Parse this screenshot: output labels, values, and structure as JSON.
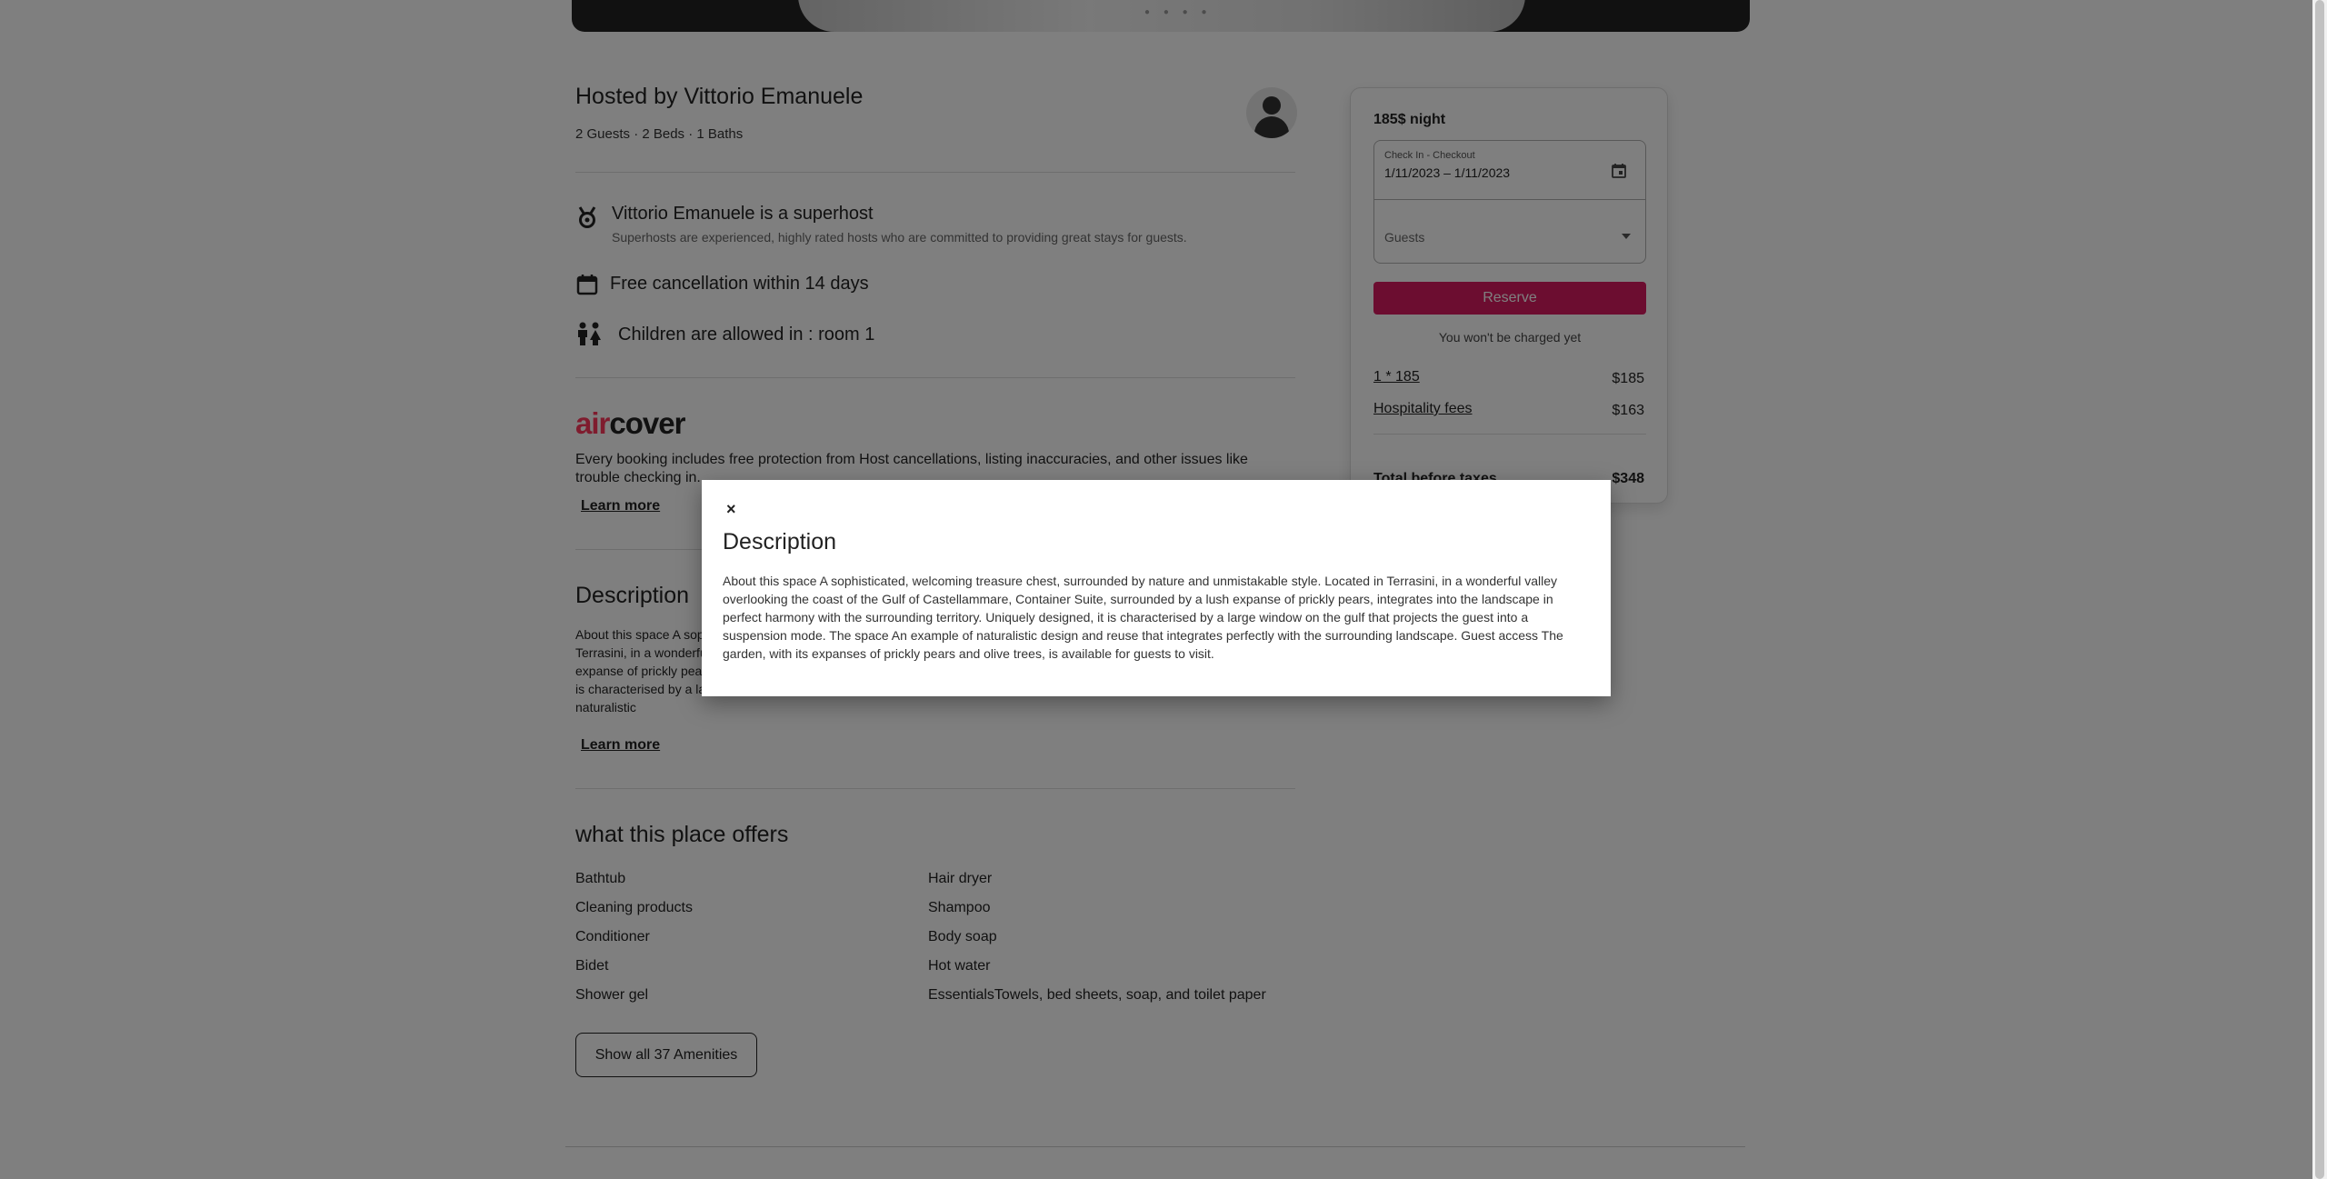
{
  "host": {
    "title": "Hosted by Vittorio Emanuele",
    "subtitle": "2 Guests · 2 Beds · 1 Baths"
  },
  "features": [
    {
      "icon": "medal-icon",
      "title": "Vittorio Emanuele is a superhost",
      "desc": "Superhosts are experienced, highly rated hosts who are committed to providing great stays for guests."
    },
    {
      "icon": "calendar-icon",
      "title": "Free cancellation within 14 days"
    },
    {
      "icon": "family-icon",
      "title": "Children are allowed in : room 1"
    }
  ],
  "aircover": {
    "logo_a": "air",
    "logo_b": "cover",
    "text": "Every booking includes free protection from Host cancellations, listing inaccuracies, and other issues like trouble checking in.",
    "learn_more": "Learn more"
  },
  "description": {
    "heading": "Description",
    "text": "About this space A sophisticated, welcoming treasure chest, surrounded by nature and unmistakable style. Located in Terrasini, in a wonderful valley overlooking the coast of the Gulf of Castellammare, Container Suite, surrounded by a lush expanse of prickly pears, integrates into the landscape in perfect harmony with the surrounding territory. Uniquely designed, it is characterised by a large window on the gulf that projects the guest into a suspension mode. The space An example of naturalistic",
    "learn_more": "Learn more"
  },
  "offers": {
    "heading": "what this place offers",
    "left": [
      "Bathtub",
      "Cleaning products",
      "Conditioner",
      "Bidet",
      "Shower gel"
    ],
    "right": [
      "Hair dryer",
      "Shampoo",
      "Body soap",
      "Hot water",
      "EssentialsTowels, bed sheets, soap, and toilet paper"
    ],
    "show_all": "Show all 37 Amenities"
  },
  "booking": {
    "price": "185$ night",
    "dates_label": "Check In - Checkout",
    "dates_value": "1/11/2023 – 1/11/2023",
    "guests_label": "Guests",
    "reserve": "Reserve",
    "no_charge": "You won't be charged yet",
    "line1_label": "1 * 185",
    "line1_value": "$185",
    "line2_label": "Hospitality fees",
    "line2_value": "$163",
    "total_label": "Total before taxes",
    "total_value": "$348",
    "accent": "#d81b60"
  },
  "modal": {
    "close": "×",
    "title": "Description",
    "body": "About this space A sophisticated, welcoming treasure chest, surrounded by nature and unmistakable style. Located in Terrasini, in a wonderful valley overlooking the coast of the Gulf of Castellammare, Container Suite, surrounded by a lush expanse of prickly pears, integrates into the landscape in perfect harmony with the surrounding territory. Uniquely designed, it is characterised by a large window on the gulf that projects the guest into a suspension mode. The space An example of naturalistic design and reuse that integrates perfectly with the surrounding landscape. Guest access The garden, with its expanses of prickly pears and olive trees, is available for guests to visit."
  }
}
